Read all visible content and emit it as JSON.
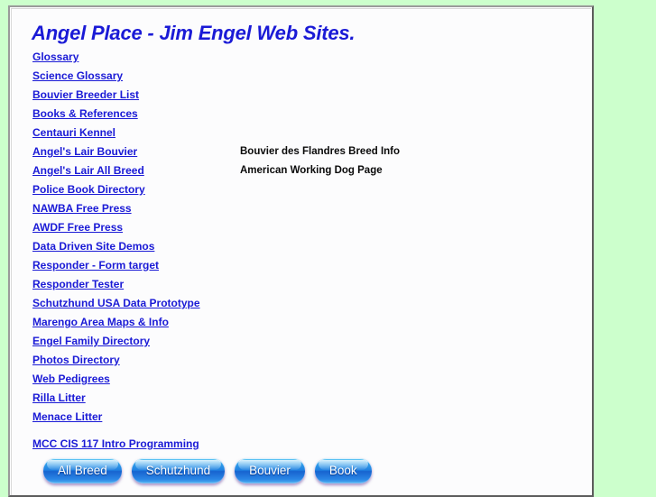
{
  "page": {
    "background_color": "#ccffcc",
    "content_background": "#fcfcfd",
    "title": "Angel Place - Jim Engel Web Sites.",
    "link_color": "#1a1ad6",
    "note_color": "#0a0a0a",
    "button_accent": "#1f7fe0"
  },
  "links": [
    {
      "label": "Glossary",
      "note": ""
    },
    {
      "label": "Science Glossary",
      "note": ""
    },
    {
      "label": "Bouvier Breeder List",
      "note": ""
    },
    {
      "label": "Books & References",
      "note": ""
    },
    {
      "label": "Centauri Kennel",
      "note": ""
    },
    {
      "label": "Angel's Lair Bouvier",
      "note": "Bouvier des Flandres Breed Info"
    },
    {
      "label": "Angel's Lair All Breed",
      "note": "American Working Dog Page"
    },
    {
      "label": "Police Book Directory",
      "note": ""
    },
    {
      "label": "NAWBA Free Press",
      "note": ""
    },
    {
      "label": "AWDF Free Press",
      "note": ""
    },
    {
      "label": "Data Driven Site Demos",
      "note": ""
    },
    {
      "label": "Responder - Form target",
      "note": ""
    },
    {
      "label": "Responder Tester",
      "note": ""
    },
    {
      "label": "Schutzhund USA Data Prototype",
      "note": ""
    },
    {
      "label": "Marengo Area Maps & Info",
      "note": ""
    },
    {
      "label": "Engel Family Directory",
      "note": ""
    },
    {
      "label": "Photos Directory",
      "note": ""
    },
    {
      "label": "Web Pedigrees",
      "note": ""
    },
    {
      "label": "Rilla Litter",
      "note": ""
    },
    {
      "label": "Menace Litter",
      "note": ""
    },
    {
      "label": "MCC CIS 117 Intro Programming",
      "note": "",
      "extra_gap": true
    }
  ],
  "buttons": [
    {
      "label": "All Breed"
    },
    {
      "label": "Schutzhund"
    },
    {
      "label": "Bouvier"
    },
    {
      "label": "Book"
    }
  ]
}
